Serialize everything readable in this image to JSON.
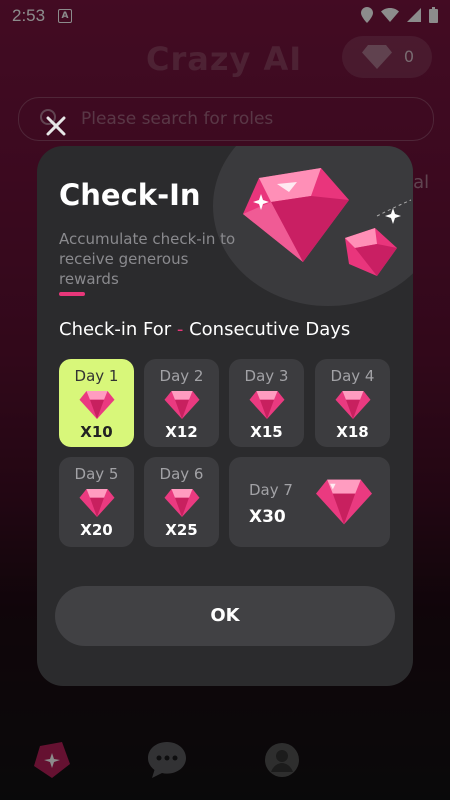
{
  "status_bar": {
    "time": "2:53",
    "a_badge": "A"
  },
  "background": {
    "app_title": "Crazy AI",
    "coins": "0",
    "search_placeholder": "Please search for roles",
    "side_text": "eal"
  },
  "checkin": {
    "title": "Check-In",
    "subtitle": "Accumulate check-in to receive generous rewards",
    "heading_left": "Check-in For",
    "heading_dash": "-",
    "heading_right": "Consecutive Days",
    "days": [
      {
        "label": "Day 1",
        "multiplier": "X10",
        "active": true
      },
      {
        "label": "Day 2",
        "multiplier": "X12",
        "active": false
      },
      {
        "label": "Day 3",
        "multiplier": "X15",
        "active": false
      },
      {
        "label": "Day 4",
        "multiplier": "X18",
        "active": false
      },
      {
        "label": "Day 5",
        "multiplier": "X20",
        "active": false
      },
      {
        "label": "Day 6",
        "multiplier": "X25",
        "active": false
      },
      {
        "label": "Day 7",
        "multiplier": "X30",
        "active": false
      }
    ],
    "ok_label": "OK"
  },
  "colors": {
    "accent": "#e8377a",
    "active_day": "#d8f77a",
    "gem": "#f0588f"
  },
  "icons": [
    "close-icon",
    "gem-icon",
    "search-icon",
    "chat-icon",
    "avatar-icon",
    "sparkle-icon"
  ]
}
